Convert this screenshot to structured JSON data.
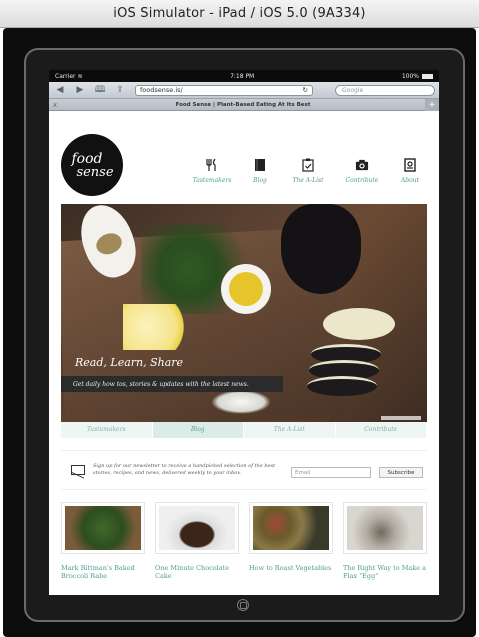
{
  "window": {
    "title": "iOS Simulator - iPad / iOS 5.0 (9A334)"
  },
  "status_bar": {
    "carrier": "Carrier",
    "time": "7:18 PM",
    "battery": "100%"
  },
  "safari": {
    "url": "foodsense.is/",
    "search_placeholder": "Google",
    "tab_title": "Food Sense | Plant-Based Eating At Its Best",
    "tab_close": "x",
    "tab_add": "+"
  },
  "site": {
    "logo": {
      "line1": "food",
      "line2": "sense"
    },
    "nav": [
      {
        "label": "Tastemakers",
        "icon": "utensils-icon"
      },
      {
        "label": "Blog",
        "icon": "book-icon"
      },
      {
        "label": "The A-List",
        "icon": "checklist-icon"
      },
      {
        "label": "Contribute",
        "icon": "camera-icon"
      },
      {
        "label": "About",
        "icon": "info-book-icon"
      }
    ],
    "hero": {
      "title": "Read, Learn, Share",
      "banner": "Get daily how tos, stories & updates with the latest news."
    },
    "feature_tabs": [
      "Tastemakers",
      "Blog",
      "The A-List",
      "Contribute"
    ],
    "newsletter": {
      "text": "Sign up for our newsletter to receive a handpicked selection of the best stories, recipes, and news, delivered weekly to your inbox.",
      "email_placeholder": "Email",
      "subscribe_label": "Subscribe"
    },
    "articles": [
      {
        "title": "Mark Bittman's Baked Broccoli Rabe"
      },
      {
        "title": "One Minute Chocolate Cake"
      },
      {
        "title": "How to Roast Vegetables"
      },
      {
        "title": "The Right Way to Make a Flax \"Egg\""
      }
    ]
  }
}
